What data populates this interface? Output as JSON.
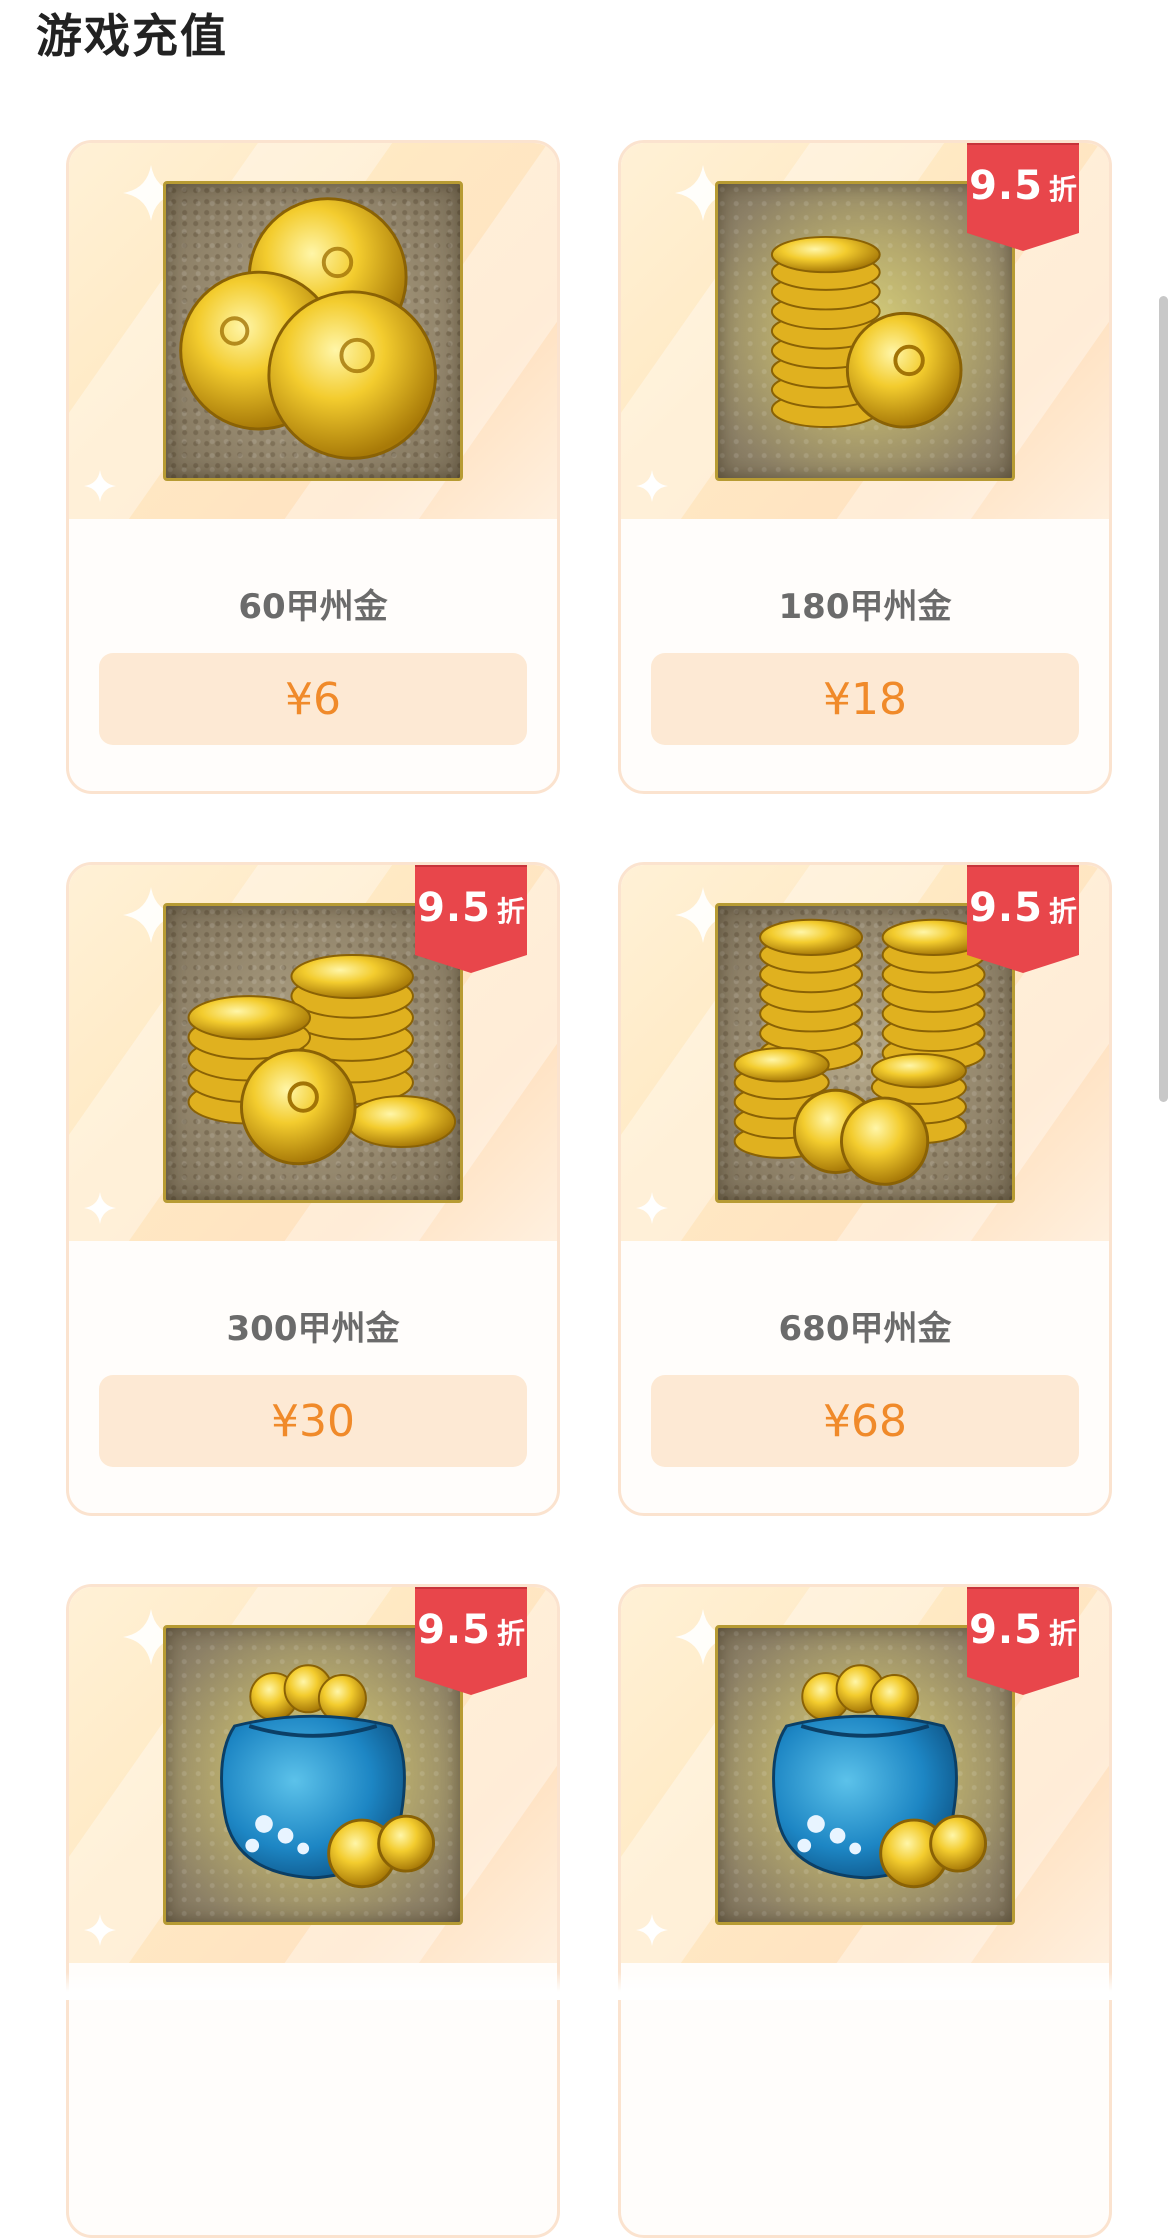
{
  "header": {
    "title": "游戏充值"
  },
  "colors": {
    "card_border": "#fbe3cf",
    "price_bg": "#fde9d4",
    "price_text": "#f08a2a",
    "badge_red": "#e8464b",
    "name_text": "#6b6b6b"
  },
  "products": [
    {
      "name": "60甲州金",
      "price": "¥6",
      "discount": null,
      "icon": "three-gold-coins-icon"
    },
    {
      "name": "180甲州金",
      "price": "¥18",
      "discount": {
        "value": "9.5",
        "unit": "折"
      },
      "icon": "gold-coin-stack-icon"
    },
    {
      "name": "300甲州金",
      "price": "¥30",
      "discount": {
        "value": "9.5",
        "unit": "折"
      },
      "icon": "gold-coin-stacks-icon"
    },
    {
      "name": "680甲州金",
      "price": "¥68",
      "discount": {
        "value": "9.5",
        "unit": "折"
      },
      "icon": "gold-coin-towers-icon"
    },
    {
      "name": "",
      "price": "",
      "discount": {
        "value": "9.5",
        "unit": "折"
      },
      "icon": "coin-pouch-icon"
    },
    {
      "name": "",
      "price": "",
      "discount": {
        "value": "9.5",
        "unit": "折"
      },
      "icon": "coin-pouch-icon"
    }
  ]
}
